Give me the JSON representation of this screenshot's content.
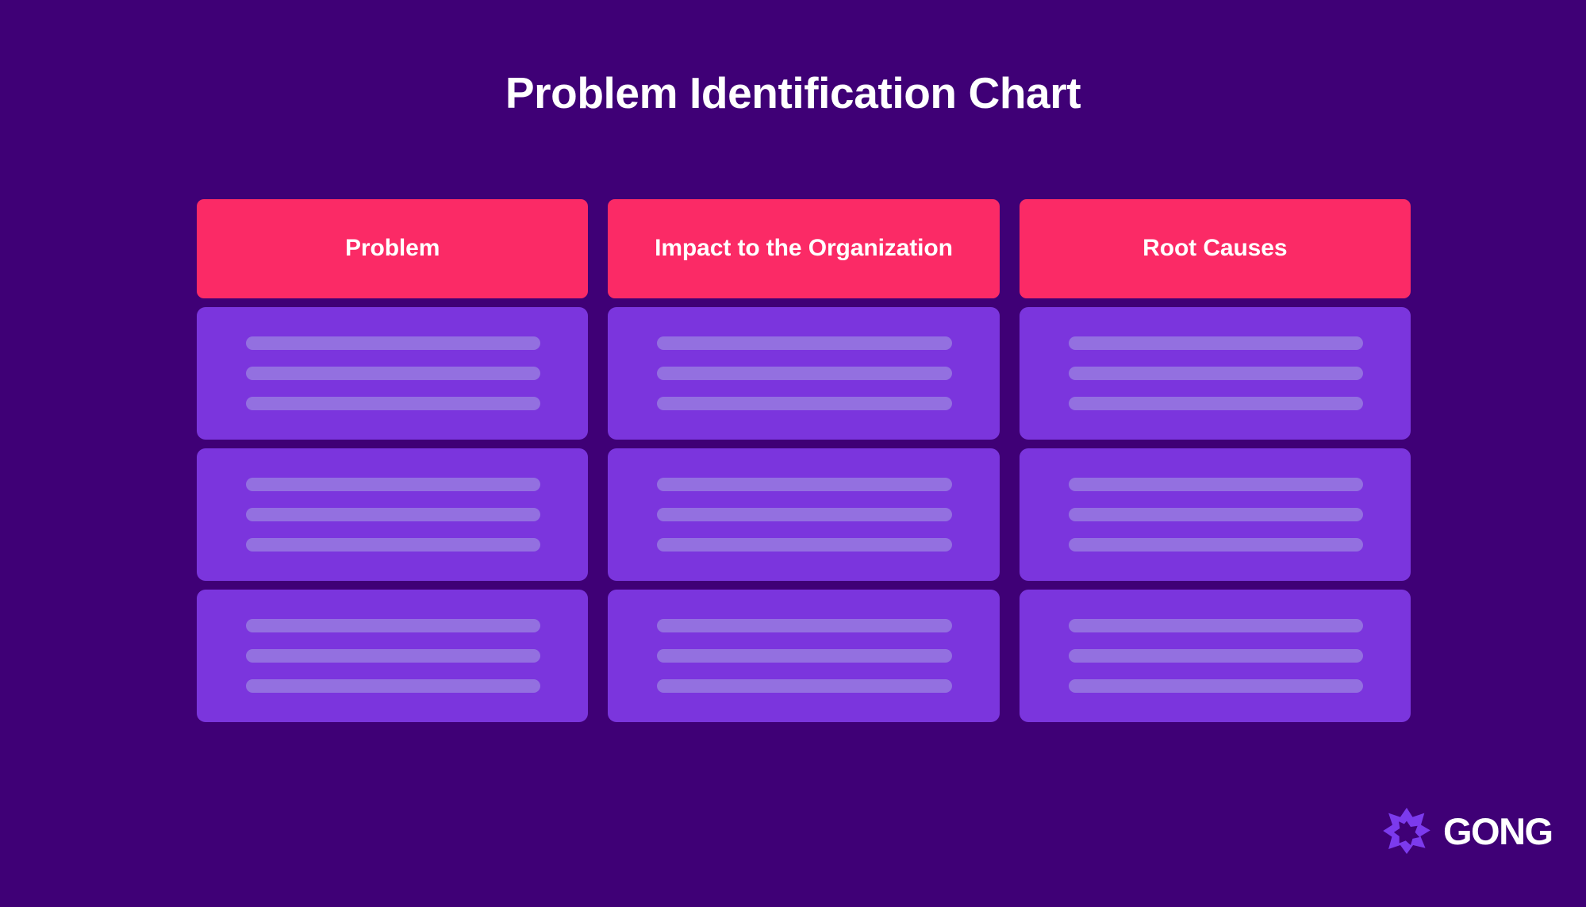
{
  "page": {
    "title": "Problem Identification Chart",
    "background_color": "#3f0076"
  },
  "colors": {
    "background": "#3f0076",
    "header_pink": "#fb2a66",
    "cell_purple": "#7b35dd",
    "placeholder_line": "#9370e0",
    "text_white": "#ffffff",
    "logo_purple": "#7c3aed"
  },
  "chart_data": {
    "type": "table",
    "title": "Problem Identification Chart",
    "columns": [
      "Problem",
      "Impact to the Organization",
      "Root Causes"
    ],
    "rows": [
      {
        "cells": [
          {
            "lines": 3,
            "text": ""
          },
          {
            "lines": 3,
            "text": ""
          },
          {
            "lines": 3,
            "text": ""
          }
        ]
      },
      {
        "cells": [
          {
            "lines": 3,
            "text": ""
          },
          {
            "lines": 3,
            "text": ""
          },
          {
            "lines": 3,
            "text": ""
          }
        ]
      },
      {
        "cells": [
          {
            "lines": 3,
            "text": ""
          },
          {
            "lines": 3,
            "text": ""
          },
          {
            "lines": 3,
            "text": ""
          }
        ]
      }
    ],
    "row_count": 3,
    "column_count": 3,
    "cells_are_blank": true,
    "note": "Blank template: every body cell shows placeholder bars instead of text"
  },
  "headers": [
    {
      "label": "Problem"
    },
    {
      "label": "Impact to the Organization"
    },
    {
      "label": "Root Causes"
    }
  ],
  "brand": {
    "name": "GONG",
    "mark": "gong-starburst-icon"
  }
}
